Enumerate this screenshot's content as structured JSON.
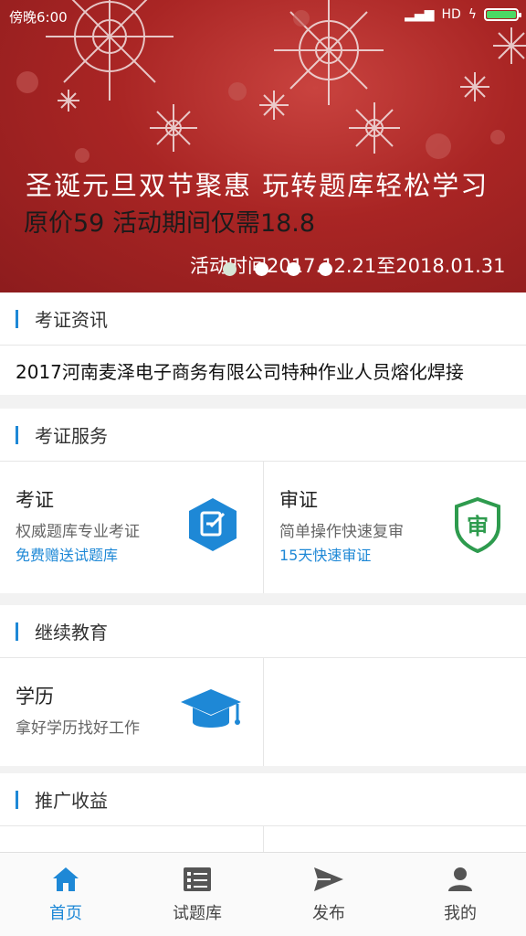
{
  "status_bar": {
    "time": "傍晚6:00",
    "network": "HD"
  },
  "banner": {
    "line1": "圣诞元旦双节聚惠  玩转题库轻松学习",
    "line2": "原价59 活动期间仅需18.8",
    "line3": "活动时间2017.12.21至2018.01.31",
    "pages": 4,
    "active_page": 1
  },
  "news": {
    "title": "考证资讯",
    "item": "2017河南麦泽电子商务有限公司特种作业人员熔化焊接"
  },
  "services": {
    "title": "考证服务",
    "items": [
      {
        "title": "考证",
        "subtitle": "权威题库专业考证",
        "link": "免费赠送试题库",
        "icon": "edit-hexagon-icon"
      },
      {
        "title": "审证",
        "subtitle": "简单操作快速复审",
        "link": "15天快速审证",
        "icon": "shield-review-icon"
      }
    ]
  },
  "education": {
    "title": "继续教育",
    "items": [
      {
        "title": "学历",
        "subtitle": "拿好学历找好工作",
        "icon": "graduation-cap-icon"
      }
    ]
  },
  "promotion": {
    "title": "推广收益"
  },
  "tabs": [
    {
      "label": "首页",
      "icon": "home-icon",
      "active": true
    },
    {
      "label": "试题库",
      "icon": "question-bank-icon",
      "active": false
    },
    {
      "label": "发布",
      "icon": "send-icon",
      "active": false
    },
    {
      "label": "我的",
      "icon": "person-icon",
      "active": false
    }
  ],
  "colors": {
    "accent": "#1e88d6",
    "banner_red": "#a92524",
    "review_green": "#2e9b4e"
  }
}
